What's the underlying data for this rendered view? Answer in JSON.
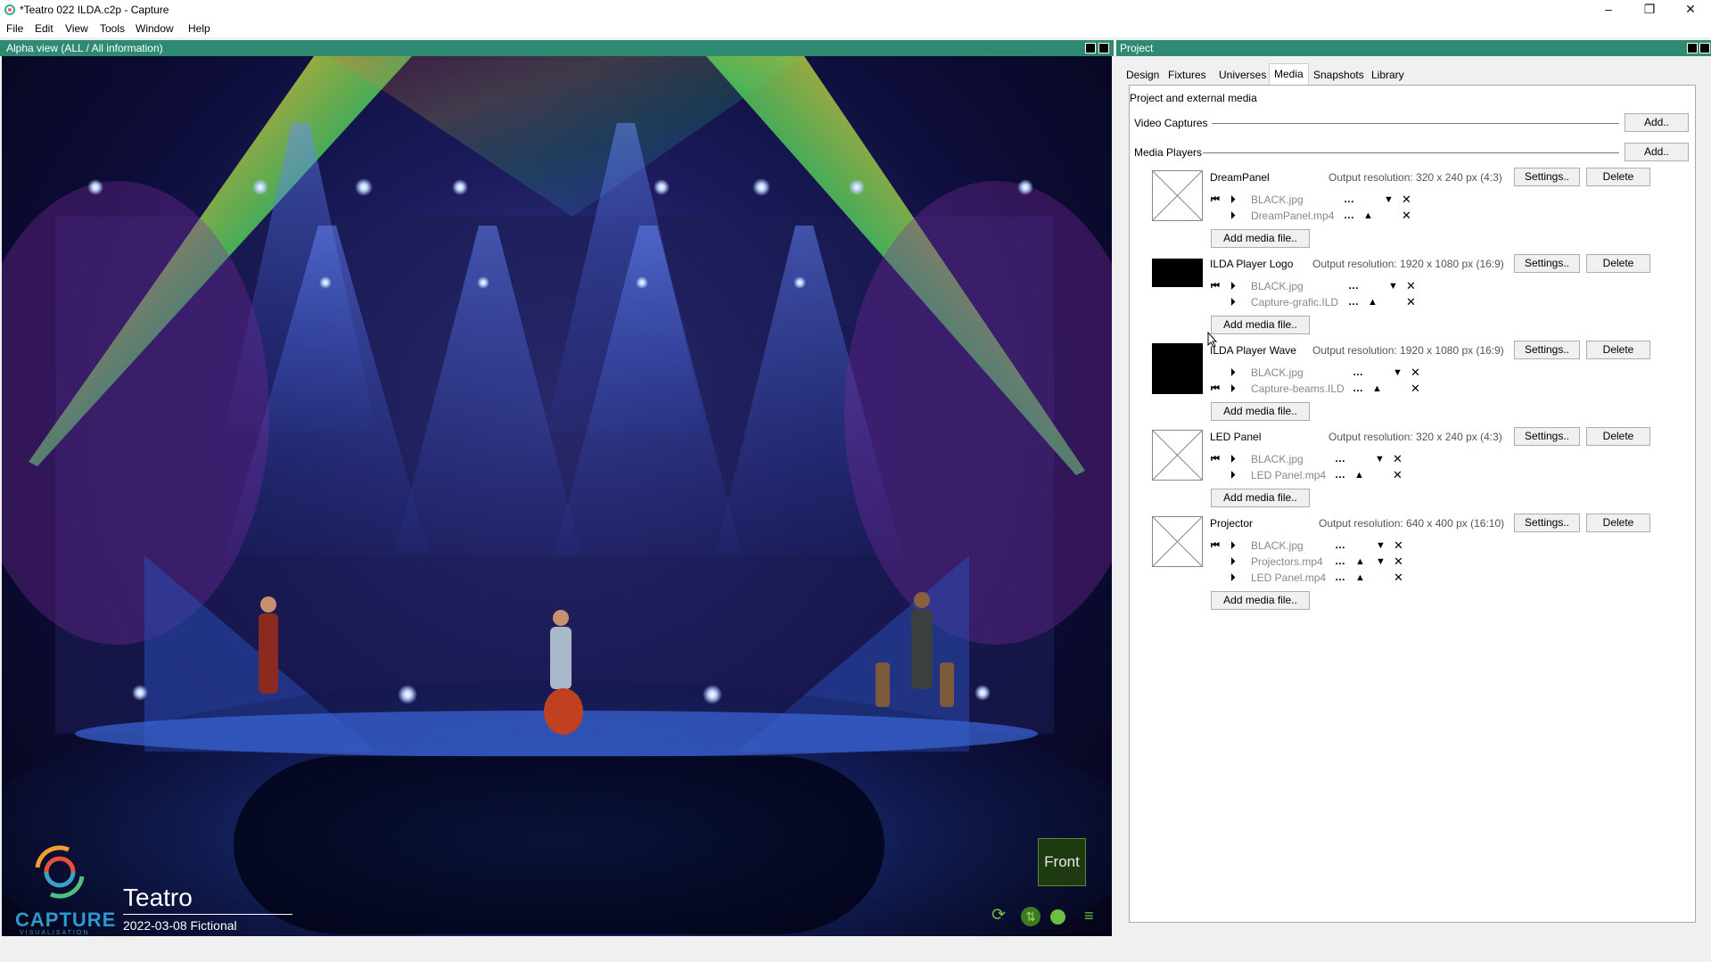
{
  "window": {
    "title": "*Teatro 022 ILDA.c2p - Capture",
    "minimize": "–",
    "maximize": "❐",
    "close": "✕"
  },
  "menu": [
    "File",
    "Edit",
    "View",
    "Tools",
    "Window",
    "Help"
  ],
  "left_panel": {
    "title": "Alpha view  (ALL / All information)",
    "logo_text": "CAPTURE",
    "logo_sub": "VISUALISATION",
    "scene_name": "Teatro",
    "scene_info": "2022-03-08 Fictional",
    "view_label": "Front"
  },
  "right_panel": {
    "title": "Project",
    "tabs": [
      "Design",
      "Fixtures",
      "Universes",
      "Media",
      "Snapshots",
      "Library"
    ],
    "active_tab": "Media",
    "section_title": "Project and external media",
    "video_captures_label": "Video Captures",
    "media_players_label": "Media Players",
    "add_label": "Add..",
    "settings_label": "Settings..",
    "delete_label": "Delete",
    "add_media_label": "Add media file..",
    "players": [
      {
        "name": "DreamPanel",
        "resolution": "Output resolution: 320 x 240 px (4:3)",
        "files": [
          "BLACK.jpg",
          "DreamPanel.mp4"
        ]
      },
      {
        "name": "ILDA Player Logo",
        "resolution": "Output resolution: 1920 x 1080 px (16:9)",
        "files": [
          "BLACK.jpg",
          "Capture-grafic.ILD"
        ]
      },
      {
        "name": "ILDA Player Wave",
        "resolution": "Output resolution: 1920 x 1080 px (16:9)",
        "files": [
          "BLACK.jpg",
          "Capture-beams.ILD"
        ]
      },
      {
        "name": "LED Panel",
        "resolution": "Output resolution: 320 x 240 px (4:3)",
        "files": [
          "BLACK.jpg",
          "LED Panel.mp4"
        ]
      },
      {
        "name": "Projector",
        "resolution": "Output resolution: 640 x 400 px (16:10)",
        "files": [
          "BLACK.jpg",
          "Projectors.mp4",
          "LED Panel.mp4"
        ]
      }
    ]
  },
  "colors": {
    "accent": "#2f8a72",
    "view_label_bg": "#1e3a10"
  }
}
